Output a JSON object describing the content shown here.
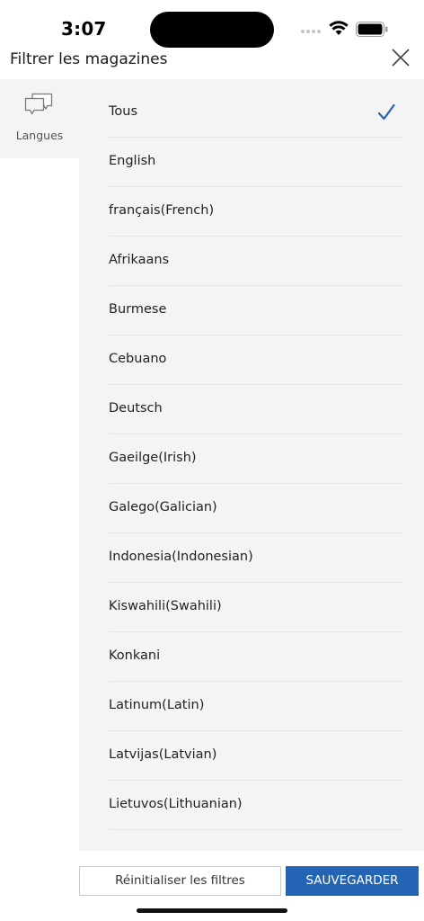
{
  "status": {
    "time": "3:07"
  },
  "header": {
    "title": "Filtrer les magazines",
    "close_icon": "close-icon"
  },
  "sidebar": {
    "tabs": [
      {
        "label": "Langues",
        "icon": "speech-bubbles-icon"
      }
    ]
  },
  "languages": {
    "selected_index": 0,
    "items": [
      "Tous",
      "English",
      "français(French)",
      "Afrikaans",
      "Burmese",
      "Cebuano",
      "Deutsch",
      "Gaeilge(Irish)",
      "Galego(Galician)",
      "Indonesia(Indonesian)",
      "Kiswahili(Swahili)",
      "Konkani",
      "Latinum(Latin)",
      "Latvijas(Latvian)",
      "Lietuvos(Lithuanian)"
    ]
  },
  "footer": {
    "reset_label": "Réinitialiser les filtres",
    "save_label": "SAUVEGARDER"
  },
  "colors": {
    "accent": "#2464b4",
    "panel_bg": "#f4f4f4"
  }
}
